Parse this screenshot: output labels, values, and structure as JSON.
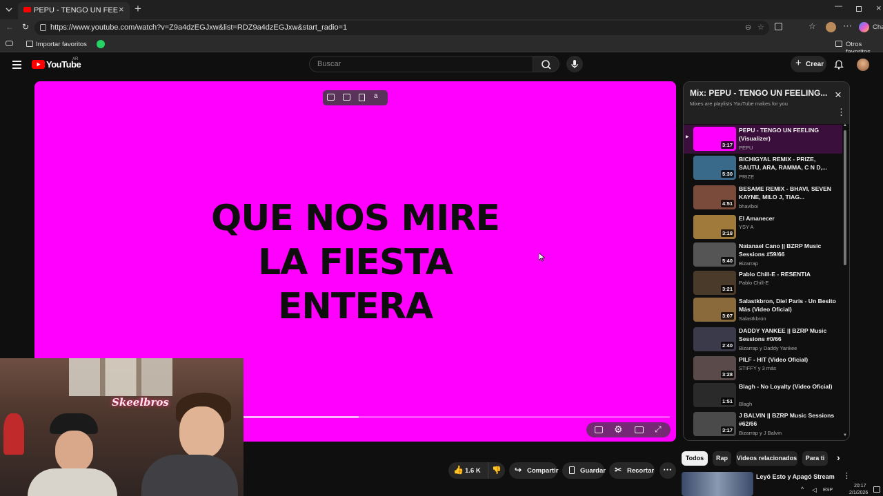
{
  "browser": {
    "tab_title": "PEPU - TENGO UN FEELING (Visu",
    "url": "https://www.youtube.com/watch?v=Z9a4dzEGJxw&list=RDZ9a4dzEGJxw&start_radio=1",
    "bookmark_import": "Importar favoritos",
    "bookmark_other": "Otros favoritos",
    "chat_label": "Cha"
  },
  "header": {
    "logo_text": "YouTube",
    "country_code": "AR",
    "search_placeholder": "Buscar",
    "create_label": "Crear"
  },
  "video": {
    "lyrics": [
      "QUE NOS MIRE",
      "LA FIESTA",
      "ENTERA"
    ],
    "progress_fraction": 0.27
  },
  "actions": {
    "like_count": "1.6 K",
    "share": "Compartir",
    "save": "Guardar",
    "clip": "Recortar"
  },
  "playlist": {
    "title": "Mix: PEPU - TENGO UN FEELING...",
    "subtitle": "Mixes are playlists YouTube makes for you",
    "items": [
      {
        "title": "PEPU - TENGO UN FEELING (Visualizer)",
        "channel": "PEPU",
        "duration": "3:17",
        "color": "#ff00ff"
      },
      {
        "title": "BICHIGYAL REMIX - PRIZE, SAUTU, ARA, RAMMA, C N D,...",
        "channel": "PRIZE",
        "duration": "5:30",
        "color": "#3a6a8a"
      },
      {
        "title": "BESAME REMIX - BHAVI, SEVEN KAYNE, MILO J, TIAG...",
        "channel": "bhaviboi",
        "duration": "4:51",
        "color": "#7a4a3a"
      },
      {
        "title": "El Amanecer",
        "channel": "YSY A",
        "duration": "3:18",
        "color": "#a07a3a"
      },
      {
        "title": "Natanael Cano || BZRP Music Sessions #59/66",
        "channel": "Bizarrap",
        "duration": "5:40",
        "color": "#555555"
      },
      {
        "title": "Pablo Chill-E - RESENTIA",
        "channel": "Pablo Chill-E",
        "duration": "3:21",
        "color": "#4a3a2a"
      },
      {
        "title": "Salastkbron, Diel Paris - Un Besito Más (Video Oficial)",
        "channel": "Salastkbron",
        "duration": "3:07",
        "color": "#8a6a3a"
      },
      {
        "title": "DADDY YANKEE || BZRP Music Sessions #0/66",
        "channel": "Bizarrap y Daddy Yankee",
        "duration": "2:40",
        "color": "#3a3a4a"
      },
      {
        "title": "PILF - HIT (Video Oficial)",
        "channel": "STIFFY y 3 más",
        "duration": "3:28",
        "color": "#5a4a4a"
      },
      {
        "title": "Blagh - No Loyalty (Video Oficial)",
        "channel": "Blagh",
        "duration": "1:51",
        "color": "#2a2a2a"
      },
      {
        "title": "J BALVIN || BZRP Music Sessions #62/66",
        "channel": "Bizarrap y J Balvin",
        "duration": "3:17",
        "color": "#4a4a4a"
      }
    ]
  },
  "chips": [
    "Todos",
    "Rap",
    "Videos relacionados",
    "Para ti"
  ],
  "next_video": {
    "title": "Leyó Esto y Apagó Stream"
  },
  "taskbar": {
    "lang": "ESP",
    "time": "20:17",
    "date": "2/1/2026"
  },
  "webcam": {
    "neon_sign": "Skeelbros"
  },
  "colors": {
    "video_bg": "#ff00ff",
    "yt_red": "#ff0000",
    "bg": "#0f0f0f"
  }
}
